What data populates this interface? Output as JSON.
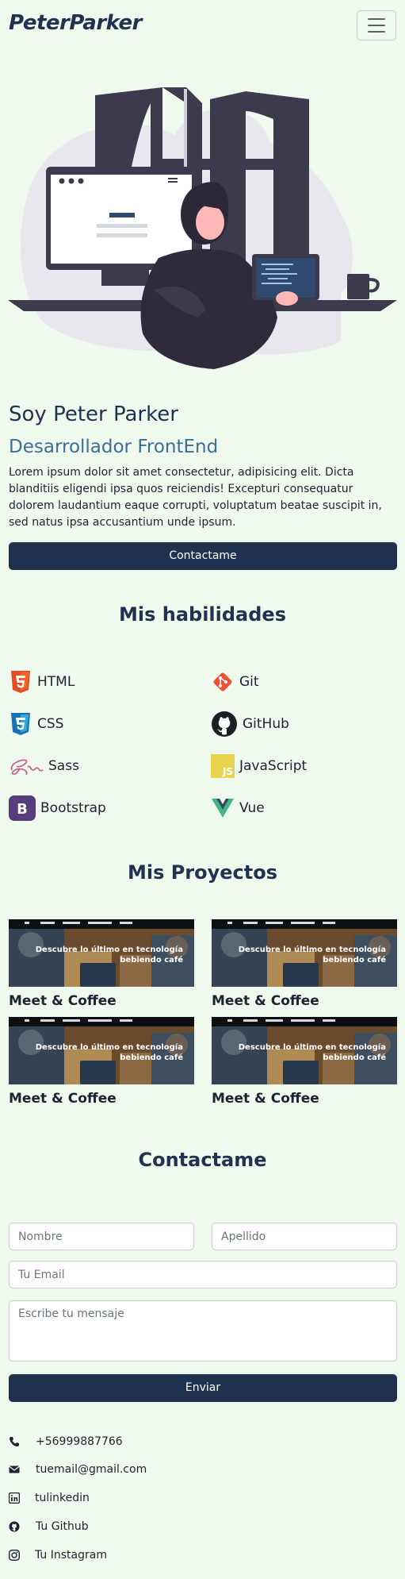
{
  "navbar": {
    "brand": "PeterParker"
  },
  "hero": {
    "title": "Soy Peter Parker",
    "subtitle": "Desarrollador FrontEnd",
    "description": "Lorem ipsum dolor sit amet consectetur, adipisicing elit. Dicta blanditiis eligendi ipsa quos reiciendis! Excepturi consequatur dolorem laudantium eaque corrupti, voluptatum beatae suscipit in, sed natus ipsa accusantium unde ipsum.",
    "cta_label": "Contactame"
  },
  "skills": {
    "title": "Mis habilidades",
    "items": [
      {
        "label": "HTML",
        "icon": "html5-icon",
        "color": "#e44d26"
      },
      {
        "label": "Git",
        "icon": "git-icon",
        "color": "#f05033"
      },
      {
        "label": "CSS",
        "icon": "css3-icon",
        "color": "#2e8dd1"
      },
      {
        "label": "GitHub",
        "icon": "github-icon",
        "color": "#1b1f23"
      },
      {
        "label": "Sass",
        "icon": "sass-icon",
        "color": "#c86493"
      },
      {
        "label": "JavaScript",
        "icon": "javascript-icon",
        "color": "#e9d44d"
      },
      {
        "label": "Bootstrap",
        "icon": "bootstrap-icon",
        "color": "#563d7c"
      },
      {
        "label": "Vue",
        "icon": "vue-icon",
        "color": "#41b883"
      }
    ]
  },
  "projects": {
    "title": "Mis Proyectos",
    "items": [
      {
        "title": "Meet & Coffee",
        "tagline_line1": "Descubre lo último en tecnología",
        "tagline_line2": "bebiendo café"
      },
      {
        "title": "Meet & Coffee",
        "tagline_line1": "Descubre lo último en tecnología",
        "tagline_line2": "bebiendo café"
      },
      {
        "title": "Meet & Coffee",
        "tagline_line1": "Descubre lo último en tecnología",
        "tagline_line2": "bebiendo café"
      },
      {
        "title": "Meet & Coffee",
        "tagline_line1": "Descubre lo último en tecnología",
        "tagline_line2": "bebiendo café"
      }
    ]
  },
  "contact": {
    "title": "Contactame",
    "first_name_placeholder": "Nombre",
    "last_name_placeholder": "Apellido",
    "email_placeholder": "Tu Email",
    "message_placeholder": "Escribe tu mensaje",
    "submit_label": "Enviar"
  },
  "contact_info": {
    "phone": "+56999887766",
    "email": "tuemail@gmail.com",
    "linkedin": "tulinkedin",
    "github": "Tu Github",
    "instagram": "Tu Instagram"
  },
  "colors": {
    "background": "#eff9ed",
    "primary": "#1f3350",
    "accent": "#3b6f96"
  }
}
